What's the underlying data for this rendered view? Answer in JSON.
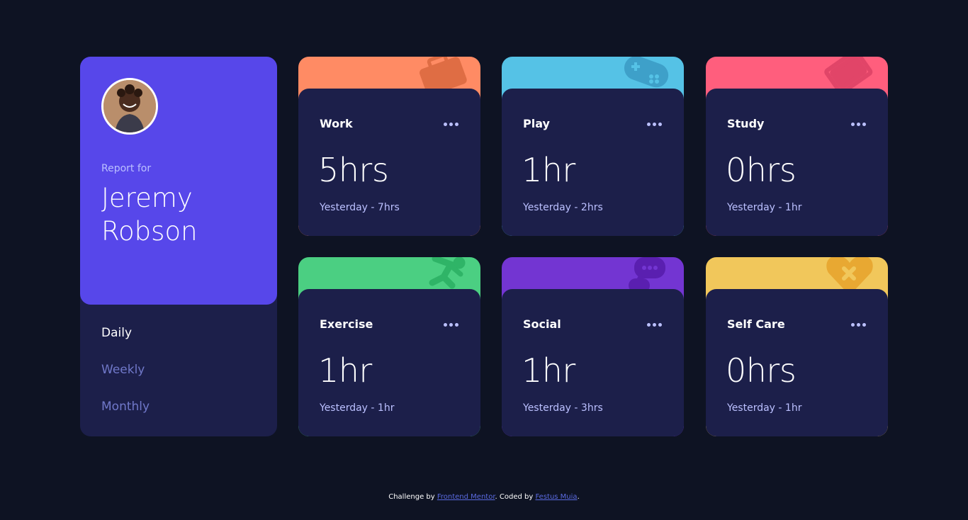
{
  "profile": {
    "report_label": "Report for",
    "name": "Jeremy Robson",
    "periods": [
      "Daily",
      "Weekly",
      "Monthly"
    ],
    "active_period": "Daily"
  },
  "cards": [
    {
      "title": "Work",
      "current": "5hrs",
      "previous": "Yesterday - 7hrs",
      "color": "#ff8b64",
      "icon": "briefcase-icon"
    },
    {
      "title": "Play",
      "current": "1hr",
      "previous": "Yesterday - 2hrs",
      "color": "#55c2e6",
      "icon": "gamepad-icon"
    },
    {
      "title": "Study",
      "current": "0hrs",
      "previous": "Yesterday - 1hr",
      "color": "#ff5e7d",
      "icon": "book-icon"
    },
    {
      "title": "Exercise",
      "current": "1hr",
      "previous": "Yesterday - 1hr",
      "color": "#4bcf82",
      "icon": "running-icon"
    },
    {
      "title": "Social",
      "current": "1hr",
      "previous": "Yesterday - 3hrs",
      "color": "#7335d2",
      "icon": "chat-icon"
    },
    {
      "title": "Self Care",
      "current": "0hrs",
      "previous": "Yesterday - 1hr",
      "color": "#f1c75b",
      "icon": "heart-icon"
    }
  ],
  "footer": {
    "prefix": "Challenge by ",
    "link1": "Frontend Mentor",
    "middle": ". Coded by ",
    "link2": "Festus Muia",
    "suffix": "."
  },
  "colors": {
    "background": "#0e1323",
    "card": "#1c1f4a",
    "accent": "#5747ea",
    "muted": "#bbc0ff",
    "inactive": "#7078c9"
  }
}
